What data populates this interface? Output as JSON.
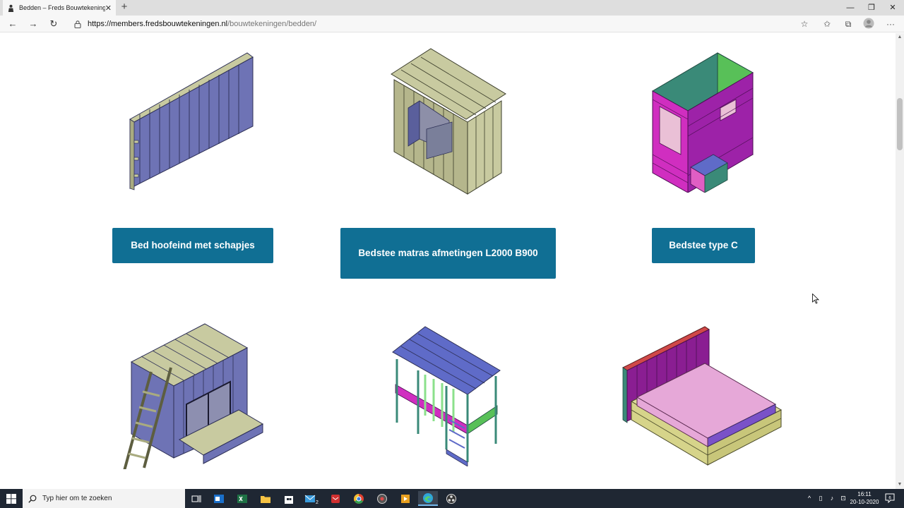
{
  "browser": {
    "tab_title": "Bedden – Freds Bouwtekeningen",
    "tab_close": "✕",
    "new_tab": "+",
    "window_controls": {
      "minimize": "—",
      "restore": "❐",
      "close": "✕"
    },
    "url_host": "https://members.fredsbouwtekeningen.nl",
    "url_path": "/bouwtekeningen/bedden/",
    "nav": {
      "back": "←",
      "forward": "→",
      "reload": "↻"
    },
    "toolbar_icons": [
      "star-icon",
      "favorites-icon",
      "collections-icon",
      "profile-icon",
      "more-icon"
    ]
  },
  "products": [
    {
      "label": "Bed hoofeind met schapjes",
      "image": "bed-headboard-shelves-illustration"
    },
    {
      "label": "Bedstee matras afmetingen L2000 B900",
      "image": "cabin-bed-illustration"
    },
    {
      "label": "Bedstee type C",
      "image": "cabin-bed-type-c-illustration"
    },
    {
      "label": "",
      "image": "loft-bed-ladder-illustration"
    },
    {
      "label": "",
      "image": "high-sleeper-illustration"
    },
    {
      "label": "",
      "image": "double-bed-illustration"
    }
  ],
  "taskbar": {
    "search_placeholder": "Typ hier om te zoeken",
    "mail_badge": "2",
    "time": "16:11",
    "date": "20-10-2020",
    "notifications": "6",
    "colors": {
      "accent": "#106f94",
      "taskbar": "#1f2733"
    }
  }
}
